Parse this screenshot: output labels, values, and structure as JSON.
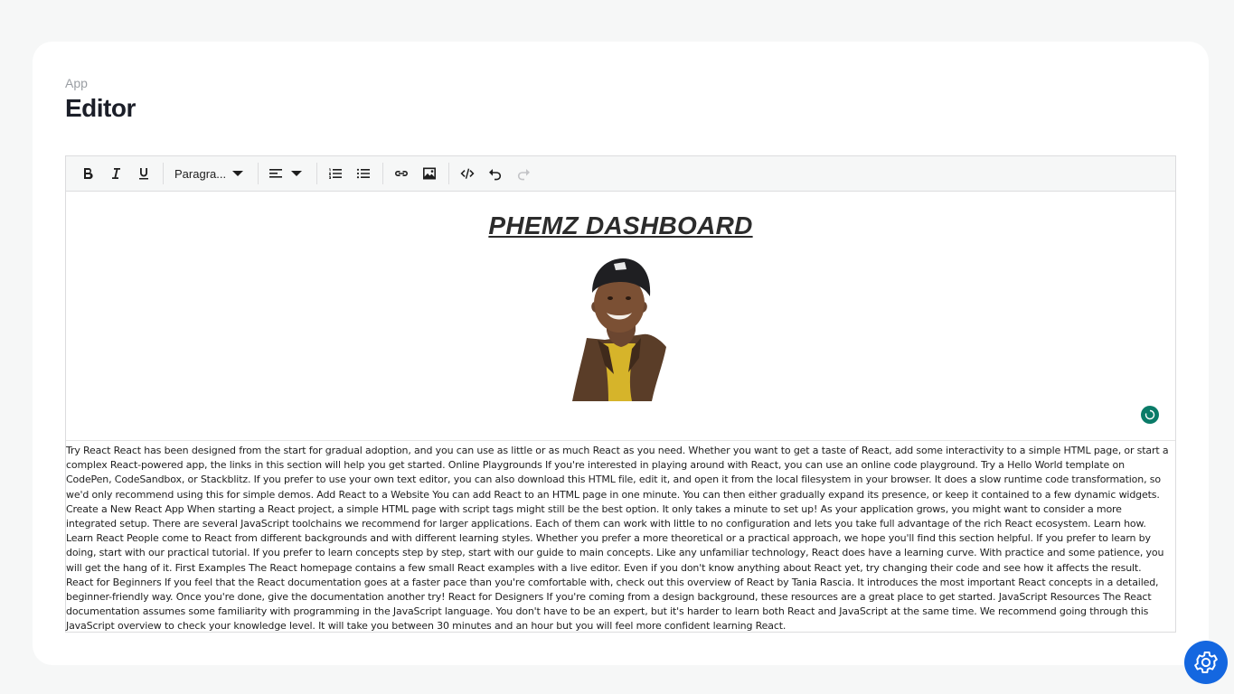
{
  "page": {
    "breadcrumb": "App",
    "title": "Editor"
  },
  "toolbar": {
    "bold_icon": "bold-icon",
    "italic_icon": "italic-icon",
    "underline_icon": "underline-icon",
    "block_format": "Paragra...",
    "align_icon": "align-left-icon",
    "numbered_list_icon": "ordered-list-icon",
    "bullet_list_icon": "bullet-list-icon",
    "link_icon": "link-icon",
    "image_icon": "image-icon",
    "code_icon": "code-icon",
    "undo_icon": "undo-icon",
    "redo_icon": "redo-icon"
  },
  "document": {
    "heading": "PHEMZ DASHBOARD",
    "image": "portrait-photo",
    "status_icon": "sync-status-icon"
  },
  "textarea": {
    "value": "Try React React has been designed from the start for gradual adoption, and you can use as little or as much React as you need. Whether you want to get a taste of React, add some interactivity to a simple HTML page, or start a complex React-powered app, the links in this section will help you get started. Online Playgrounds If you're interested in playing around with React, you can use an online code playground. Try a Hello World template on CodePen, CodeSandbox, or Stackblitz. If you prefer to use your own text editor, you can also download this HTML file, edit it, and open it from the local filesystem in your browser. It does a slow runtime code transformation, so we'd only recommend using this for simple demos. Add React to a Website You can add React to an HTML page in one minute. You can then either gradually expand its presence, or keep it contained to a few dynamic widgets. Create a New React App When starting a React project, a simple HTML page with script tags might still be the best option. It only takes a minute to set up! As your application grows, you might want to consider a more integrated setup. There are several JavaScript toolchains we recommend for larger applications. Each of them can work with little to no configuration and lets you take full advantage of the rich React ecosystem. Learn how. Learn React People come to React from different backgrounds and with different learning styles. Whether you prefer a more theoretical or a practical approach, we hope you'll find this section helpful. If you prefer to learn by doing, start with our practical tutorial. If you prefer to learn concepts step by step, start with our guide to main concepts. Like any unfamiliar technology, React does have a learning curve. With practice and some patience, you will get the hang of it. First Examples The React homepage contains a few small React examples with a live editor. Even if you don't know anything about React yet, try changing their code and see how it affects the result. React for Beginners If you feel that the React documentation goes at a faster pace than you're comfortable with, check out this overview of React by Tania Rascia. It introduces the most important React concepts in a detailed, beginner-friendly way. Once you're done, give the documentation another try! React for Designers If you're coming from a design background, these resources are a great place to get started. JavaScript Resources The React documentation assumes some familiarity with programming in the JavaScript language. You don't have to be an expert, but it's harder to learn both React and JavaScript at the same time. We recommend going through this JavaScript overview to check your knowledge level. It will take you between 30 minutes and an hour but you will feel more confident learning React."
  },
  "fab": {
    "icon": "gear-icon",
    "color": "#1467e0"
  },
  "colors": {
    "status_green": "#0a7b68"
  }
}
